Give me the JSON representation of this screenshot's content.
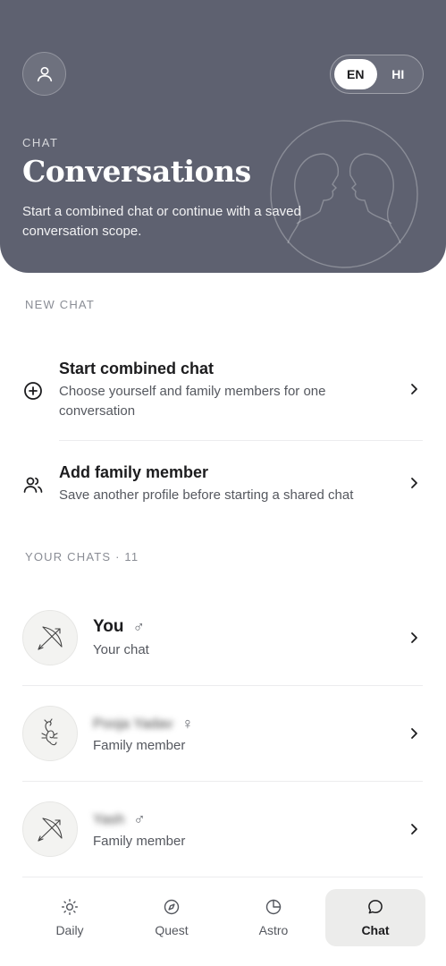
{
  "header": {
    "eyebrow": "CHAT",
    "title": "Conversations",
    "subtitle": "Start a combined chat or continue with a saved conversation scope.",
    "languages": [
      {
        "label": "EN",
        "active": true
      },
      {
        "label": "HI",
        "active": false
      }
    ],
    "profile_icon": "user-icon",
    "art_icon": "gemini-twins-icon"
  },
  "new_chat": {
    "section_label": "NEW CHAT",
    "actions": [
      {
        "title": "Start combined chat",
        "description": "Choose yourself and family members for one conversation",
        "icon": "plus-circle-icon"
      },
      {
        "title": "Add family member",
        "description": "Save another profile before starting a shared chat",
        "icon": "users-icon"
      }
    ]
  },
  "your_chats": {
    "section_label": "YOUR CHATS · 11",
    "items": [
      {
        "name": "You",
        "gender": "♂",
        "subtitle": "Your chat",
        "sign_icon": "sagittarius-icon"
      },
      {
        "name": "Pooja Yadav",
        "gender": "♀",
        "subtitle": "Family member",
        "sign_icon": "scorpio-icon"
      },
      {
        "name": "Yash",
        "gender": "♂",
        "subtitle": "Family member",
        "sign_icon": "sagittarius-icon"
      }
    ]
  },
  "tabbar": {
    "tabs": [
      {
        "label": "Daily",
        "icon": "sun-icon",
        "active": false
      },
      {
        "label": "Quest",
        "icon": "compass-icon",
        "active": false
      },
      {
        "label": "Astro",
        "icon": "pie-chart-icon",
        "active": false
      },
      {
        "label": "Chat",
        "icon": "chat-bubble-icon",
        "active": true
      }
    ]
  },
  "colors": {
    "hero_bg": "#5e6170",
    "active_tab_bg": "#ececeb",
    "muted_text": "#8a8d95"
  }
}
